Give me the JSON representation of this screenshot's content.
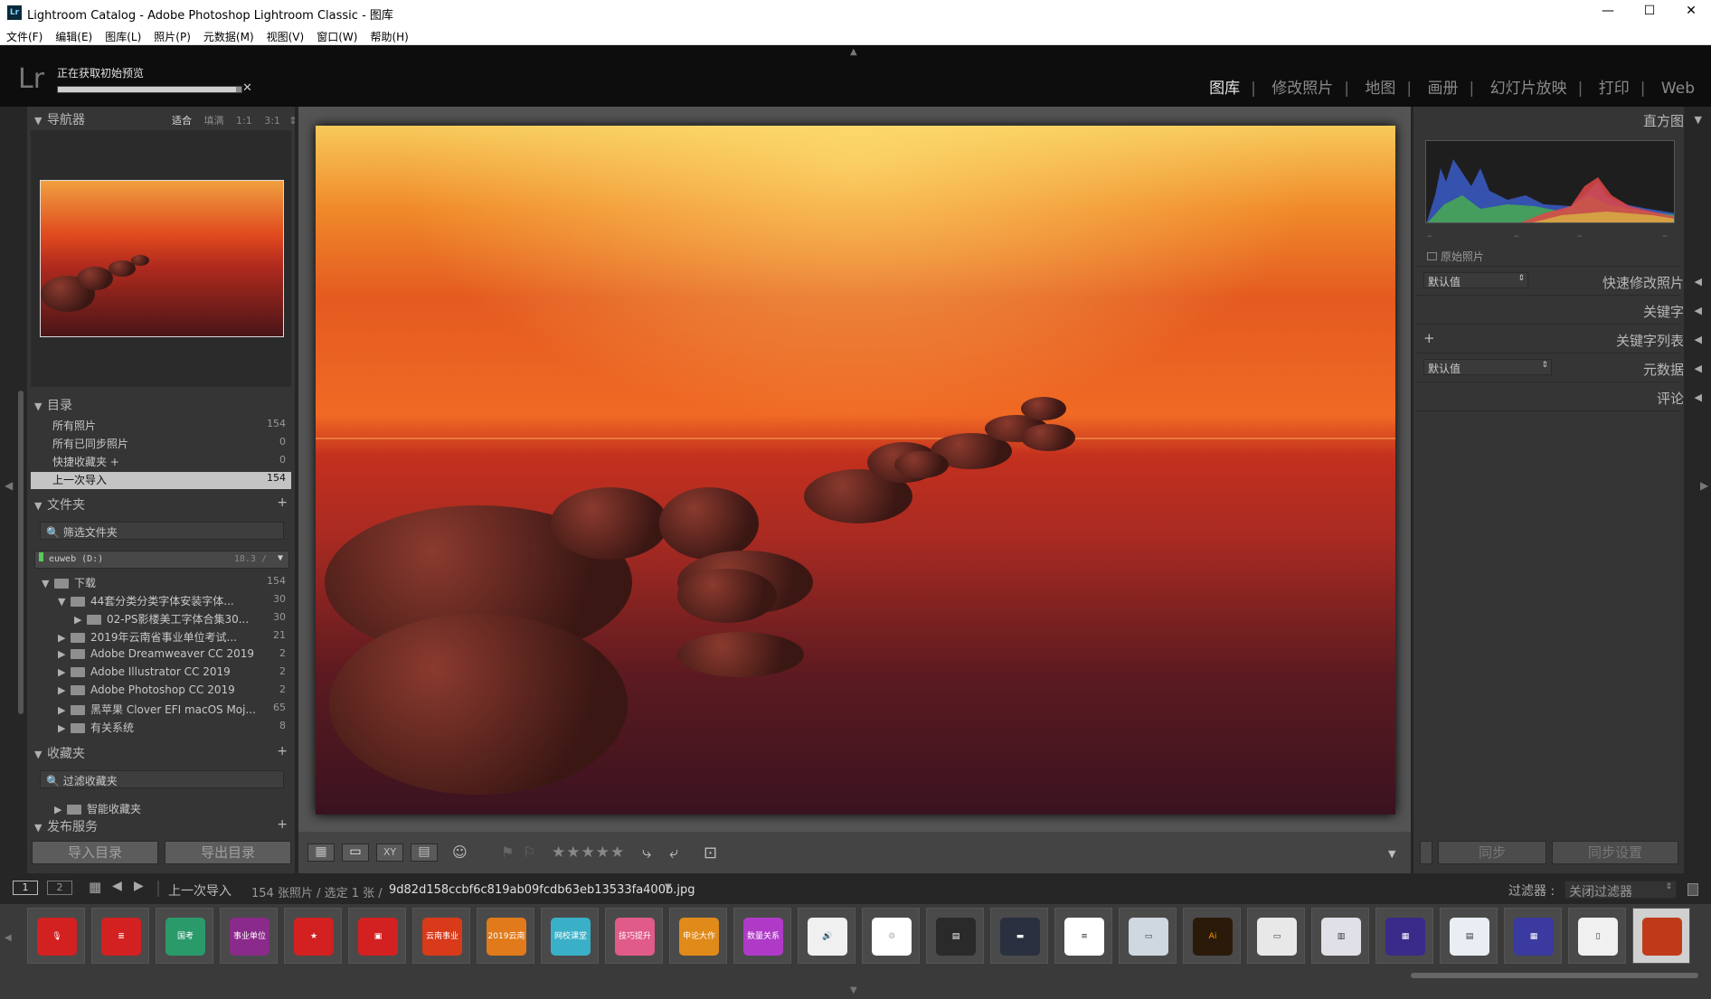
{
  "window": {
    "title": "Lightroom Catalog - Adobe Photoshop Lightroom Classic - 图库",
    "app_icon": "Lr"
  },
  "menu": [
    "文件(F)",
    "编辑(E)",
    "图库(L)",
    "照片(P)",
    "元数据(M)",
    "视图(V)",
    "窗口(W)",
    "帮助(H)"
  ],
  "identity": {
    "logo": "Lr",
    "status": "正在获取初始预览",
    "progress": 0.97
  },
  "modules": [
    "图库",
    "修改照片",
    "地图",
    "画册",
    "幻灯片放映",
    "打印",
    "Web"
  ],
  "active_module": "图库",
  "navigator": {
    "title": "导航器",
    "zoom": [
      "适合",
      "填满",
      "1:1",
      "3:1"
    ],
    "zoom_more": "⇕"
  },
  "catalog": {
    "title": "目录",
    "items": [
      {
        "label": "所有照片",
        "count": "154"
      },
      {
        "label": "所有已同步照片",
        "count": "0"
      },
      {
        "label": "快捷收藏夹 +",
        "count": "0"
      },
      {
        "label": "上一次导入",
        "count": "154"
      }
    ]
  },
  "folders": {
    "title": "文件夹",
    "add": "+",
    "filter_placeholder": "筛选文件夹",
    "volume": {
      "name": "euweb (D:)",
      "size": "18.3 /",
      "arrow": "▼"
    },
    "tree": [
      {
        "label": "下载",
        "count": "154",
        "depth": 0,
        "open": true
      },
      {
        "label": "44套分类分类字体安装字体...",
        "count": "30",
        "depth": 1,
        "open": true
      },
      {
        "label": "02-PS影楼美工字体合集30...",
        "count": "30",
        "depth": 2,
        "open": false
      },
      {
        "label": "2019年云南省事业单位考试...",
        "count": "21",
        "depth": 1,
        "open": false
      },
      {
        "label": "Adobe Dreamweaver CC 2019",
        "count": "2",
        "depth": 1,
        "open": false
      },
      {
        "label": "Adobe Illustrator CC 2019",
        "count": "2",
        "depth": 1,
        "open": false
      },
      {
        "label": "Adobe Photoshop CC 2019",
        "count": "2",
        "depth": 1,
        "open": false
      },
      {
        "label": "黑苹果 Clover EFI macOS Moj...",
        "count": "65",
        "depth": 1,
        "open": false
      },
      {
        "label": "有关系统",
        "count": "8",
        "depth": 1,
        "open": false
      }
    ]
  },
  "collections": {
    "title": "收藏夹",
    "add": "+",
    "filter_placeholder": "过滤收藏夹",
    "smart": "智能收藏夹"
  },
  "publish": {
    "title": "发布服务",
    "add": "+"
  },
  "left_buttons": {
    "import": "导入目录",
    "export": "导出目录"
  },
  "histogram": {
    "title": "直方图",
    "original": "原始照片",
    "ticks": [
      "–",
      "–",
      "–",
      "–"
    ]
  },
  "quick_develop": {
    "title": "快速修改照片",
    "preset": "默认值"
  },
  "keywording": {
    "title": "关键字"
  },
  "keyword_list": {
    "title": "关键字列表",
    "add": "+"
  },
  "metadata": {
    "title": "元数据",
    "preset": "默认值"
  },
  "comments": {
    "title": "评论"
  },
  "right_buttons": {
    "sync": "同步",
    "sync_settings": "同步设置"
  },
  "toolbar": {
    "stars": "★★★★★",
    "xy": "XY"
  },
  "filmbar": {
    "pages": [
      "1",
      "2"
    ],
    "source": "上一次导入",
    "info": "154 张照片 / 选定 1 张 /",
    "filename": "9d82d158ccbf6c819ab09fcdb63eb13533fa400b.jpg",
    "filter_label": "过滤器 :",
    "filter_value": "关闭过滤器"
  },
  "thumbs": [
    {
      "text": "🎙",
      "bg": "#d32020"
    },
    {
      "text": "≣",
      "bg": "#d32020"
    },
    {
      "text": "国考",
      "bg": "#2a9a6a"
    },
    {
      "text": "事业单位",
      "bg": "#8a2a8a"
    },
    {
      "text": "★",
      "bg": "#d32020"
    },
    {
      "text": "▣",
      "bg": "#d32020"
    },
    {
      "text": "云南事业单位",
      "bg": "#d83a1a"
    },
    {
      "text": "2019云南",
      "bg": "#e07a1a"
    },
    {
      "text": "网校课堂",
      "bg": "#3ab0c8"
    },
    {
      "text": "技巧提升",
      "bg": "#e05a8a"
    },
    {
      "text": "申论大作文",
      "bg": "#e08a1a"
    },
    {
      "text": "数量关系",
      "bg": "#b03ac8"
    },
    {
      "text": "🔊",
      "bg": "#f0f0f0"
    },
    {
      "text": "♲",
      "bg": "#ffffff"
    },
    {
      "text": "▤",
      "bg": "#2a2a2a"
    },
    {
      "text": "▬",
      "bg": "#2a3040"
    },
    {
      "text": "≡",
      "bg": "#ffffff"
    },
    {
      "text": "▭",
      "bg": "#cfd8e0"
    },
    {
      "text": "Ai",
      "bg": "#2b1a0a"
    },
    {
      "text": "▭",
      "bg": "#e8e8e8"
    },
    {
      "text": "▥",
      "bg": "#e0e0e8"
    },
    {
      "text": "▦",
      "bg": "#3a2a8a"
    },
    {
      "text": "▤",
      "bg": "#e8eef4"
    },
    {
      "text": "▦",
      "bg": "#3a3aa0"
    },
    {
      "text": "▯",
      "bg": "#f0f0f0"
    },
    {
      "text": "",
      "bg": "#c03a1a"
    }
  ]
}
